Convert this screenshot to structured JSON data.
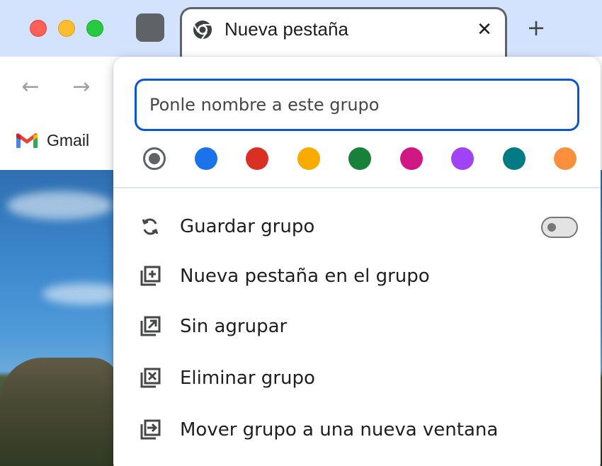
{
  "window": {
    "tab": {
      "title": "Nueva pestaña",
      "close_glyph": "✕",
      "favicon": "chrome-icon"
    },
    "new_tab_glyph": "+",
    "group_chip_color": "#5f6368"
  },
  "toolbar": {
    "back_glyph": "←",
    "forward_glyph": "→",
    "bookmark": {
      "label": "Gmail",
      "icon": "gmail-icon"
    }
  },
  "popup": {
    "name_input": {
      "placeholder": "Ponle nombre a este grupo",
      "value": ""
    },
    "colors": [
      {
        "name": "grey",
        "hex": "#5f6368",
        "selected": true
      },
      {
        "name": "blue",
        "hex": "#1a73e8",
        "selected": false
      },
      {
        "name": "red",
        "hex": "#d93025",
        "selected": false
      },
      {
        "name": "yellow",
        "hex": "#f9ab00",
        "selected": false
      },
      {
        "name": "green",
        "hex": "#188038",
        "selected": false
      },
      {
        "name": "pink",
        "hex": "#d01884",
        "selected": false
      },
      {
        "name": "purple",
        "hex": "#a142f4",
        "selected": false
      },
      {
        "name": "cyan",
        "hex": "#007b83",
        "selected": false
      },
      {
        "name": "orange",
        "hex": "#fa903e",
        "selected": false
      }
    ],
    "items": [
      {
        "label": "Guardar grupo",
        "icon": "sync-icon",
        "toggle": false
      },
      {
        "label": "Nueva pestaña en el grupo",
        "icon": "add-tab-icon"
      },
      {
        "label": "Sin agrupar",
        "icon": "ungroup-icon"
      },
      {
        "label": "Eliminar grupo",
        "icon": "delete-group-icon"
      },
      {
        "label": "Mover grupo a una nueva ventana",
        "icon": "move-window-icon"
      }
    ]
  }
}
